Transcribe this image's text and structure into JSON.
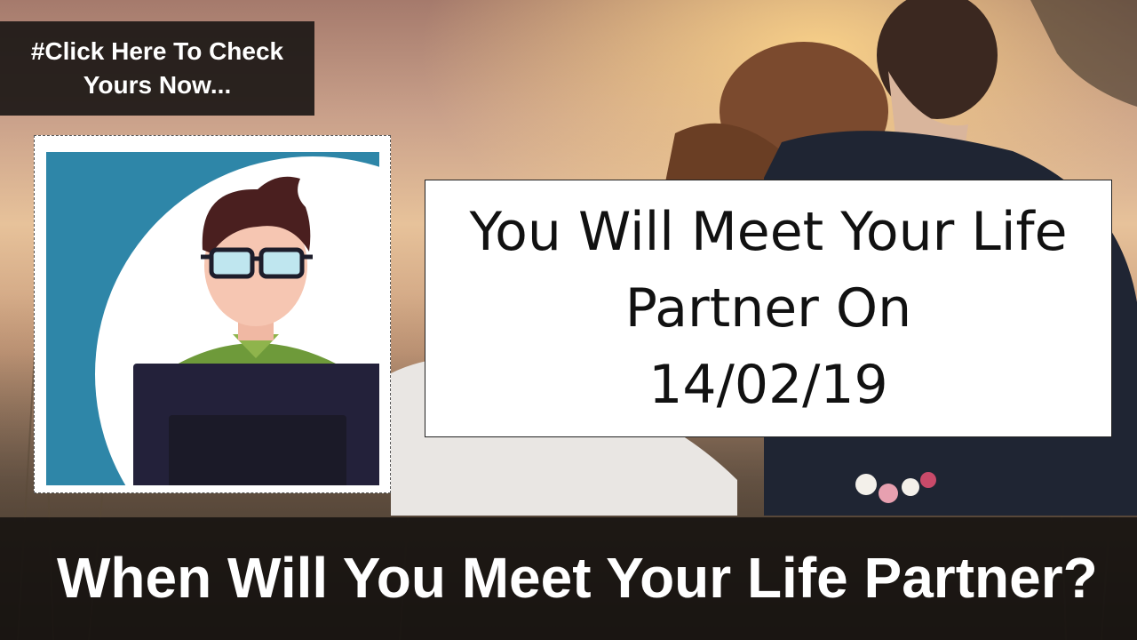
{
  "cta": {
    "line1": "#Click Here To Check",
    "line2": "Yours Now..."
  },
  "result": {
    "line1": "You Will Meet Your Life",
    "line2": "Partner On",
    "date": "14/02/19"
  },
  "banner": {
    "title": "When Will You Meet Your Life Partner?"
  },
  "colors": {
    "avatar_blue": "#2E86A8",
    "hair": "#4A1F1F",
    "shirt": "#6E9A3A",
    "laptop": "#23213A"
  },
  "icons": {
    "avatar": "person-at-laptop-icon"
  }
}
